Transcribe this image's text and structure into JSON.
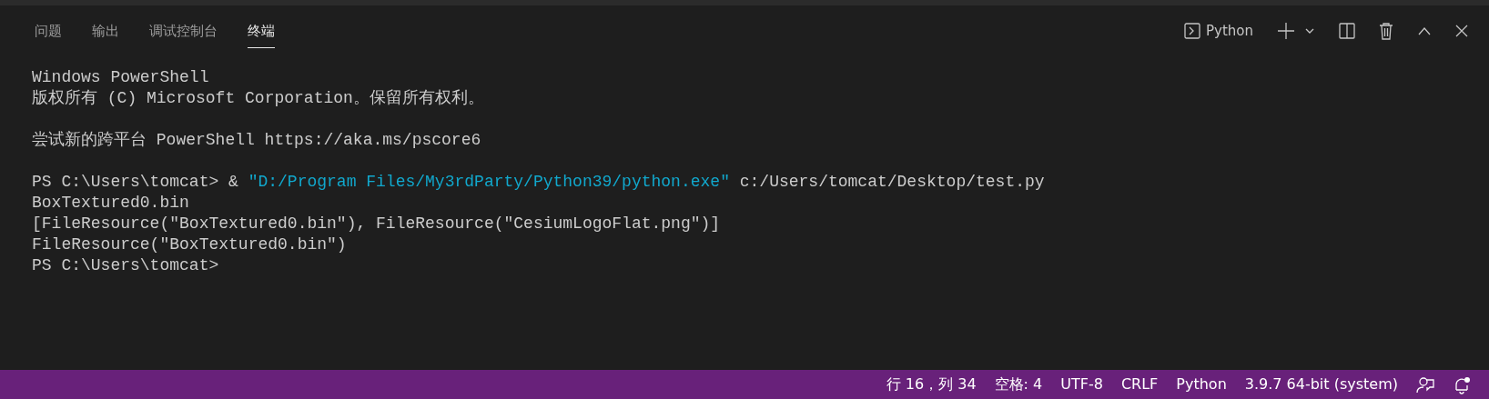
{
  "tabs": [
    {
      "label": "问题",
      "selected": false
    },
    {
      "label": "输出",
      "selected": false
    },
    {
      "label": "调试控制台",
      "selected": false
    },
    {
      "label": "终端",
      "selected": true
    }
  ],
  "terminal_profile": {
    "label": "Python"
  },
  "terminal_lines": [
    {
      "kind": "text",
      "segments": [
        {
          "kind": "plain",
          "text": "Windows PowerShell"
        }
      ]
    },
    {
      "kind": "text",
      "segments": [
        {
          "kind": "plain",
          "text": "版权所有 (C) Microsoft Corporation。保留所有权利。"
        }
      ]
    },
    {
      "kind": "blank"
    },
    {
      "kind": "text",
      "segments": [
        {
          "kind": "plain",
          "text": "尝试新的跨平台 PowerShell https://aka.ms/pscore6"
        }
      ]
    },
    {
      "kind": "blank"
    },
    {
      "kind": "text",
      "segments": [
        {
          "kind": "plain",
          "text": "PS C:\\Users\\tomcat> & "
        },
        {
          "kind": "string",
          "text": "\"D:/Program Files/My3rdParty/Python39/python.exe\""
        },
        {
          "kind": "plain",
          "text": " c:/Users/tomcat/Desktop/test.py"
        }
      ]
    },
    {
      "kind": "text",
      "segments": [
        {
          "kind": "plain",
          "text": "BoxTextured0.bin"
        }
      ]
    },
    {
      "kind": "text",
      "segments": [
        {
          "kind": "plain",
          "text": "[FileResource(\"BoxTextured0.bin\"), FileResource(\"CesiumLogoFlat.png\")]"
        }
      ]
    },
    {
      "kind": "text",
      "segments": [
        {
          "kind": "plain",
          "text": "FileResource(\"BoxTextured0.bin\")"
        }
      ]
    },
    {
      "kind": "text",
      "segments": [
        {
          "kind": "plain",
          "text": "PS C:\\Users\\tomcat>"
        }
      ]
    }
  ],
  "status_bar": {
    "items": [
      "行 16，列 34",
      "空格: 4",
      "UTF-8",
      "CRLF",
      "Python",
      "3.9.7 64-bit (system)"
    ],
    "notification_pending": true
  }
}
